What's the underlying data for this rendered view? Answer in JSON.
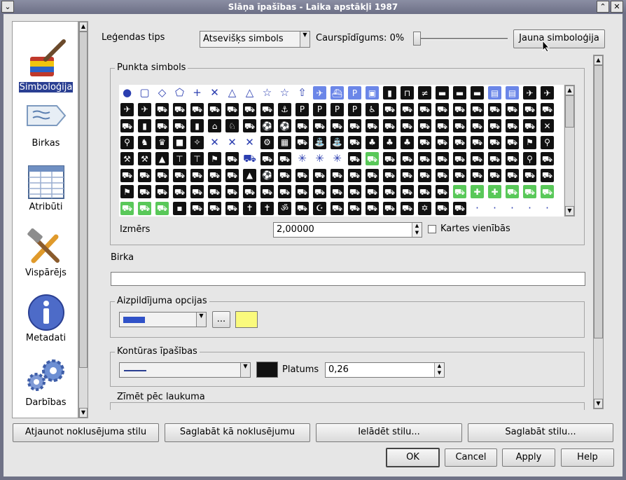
{
  "window": {
    "title": "Slāņa īpašības - Laika apstākļi 1987"
  },
  "sidebar": {
    "items": [
      {
        "label": "Simboloģija",
        "icon": "paintbrush-icon",
        "selected": true
      },
      {
        "label": "Birkas",
        "icon": "label-tag-icon"
      },
      {
        "label": "Atribūti",
        "icon": "table-icon"
      },
      {
        "label": "Vispārējs",
        "icon": "tools-icon"
      },
      {
        "label": "Metadati",
        "icon": "info-icon"
      },
      {
        "label": "Darbības",
        "icon": "gears-icon"
      }
    ]
  },
  "symbology": {
    "legend_type_label": "Leģendas tips",
    "legend_type_value": "Atsevišķs simbols",
    "transparency_label": "Caurspīdīgums: 0%",
    "transparency_value": 0,
    "new_symbology_button": "Jauna simboloģija",
    "point_symbol_group": "Punkta simbols",
    "size_label": "Izmērs",
    "size_value": "2,00000",
    "map_units_label": "Kartes vienībās",
    "map_units_checked": false,
    "label_group": "Birka",
    "label_value": "",
    "fill_options_group": "Aizpildījuma opcijas",
    "fill_color": "#3052c8",
    "fill_color2": "#fafa7d",
    "fill_more_button": "...",
    "outline_group": "Kontūras īpašības",
    "outline_color": "#111111",
    "width_label": "Platums",
    "width_value": "0,26",
    "draw_by_field_group": "Zīmēt pēc laukuma"
  },
  "symbols": [
    {
      "t": "o",
      "g": "●"
    },
    {
      "t": "o",
      "g": "▢"
    },
    {
      "t": "o",
      "g": "◇"
    },
    {
      "t": "o",
      "g": "⬠"
    },
    {
      "t": "o",
      "g": "+"
    },
    {
      "t": "o",
      "g": "✕"
    },
    {
      "t": "o",
      "g": "△"
    },
    {
      "t": "o",
      "g": "△"
    },
    {
      "t": "o",
      "g": "☆"
    },
    {
      "t": "o",
      "g": "☆"
    },
    {
      "t": "o",
      "g": "⇧"
    },
    {
      "t": "l",
      "g": "✈"
    },
    {
      "t": "l",
      "g": "⛴"
    },
    {
      "t": "l",
      "g": "P"
    },
    {
      "t": "l",
      "g": "▣"
    },
    {
      "t": "b",
      "g": "▮"
    },
    {
      "t": "b",
      "g": "⊓"
    },
    {
      "t": "b",
      "g": "≠"
    },
    {
      "t": "b",
      "g": "▬"
    },
    {
      "t": "b",
      "g": "▬"
    },
    {
      "t": "b",
      "g": "▬"
    },
    {
      "t": "l",
      "g": "▤"
    },
    {
      "t": "l",
      "g": "▤"
    },
    {
      "t": "b",
      "g": "✈"
    },
    {
      "t": "b",
      "g": "✈"
    },
    {
      "t": "b",
      "g": "✈"
    },
    {
      "t": "b",
      "g": "✈"
    },
    {
      "t": "b",
      "g": "⛟"
    },
    {
      "t": "b",
      "g": "⛟"
    },
    {
      "t": "b",
      "g": "⛟"
    },
    {
      "t": "b",
      "g": "⛟"
    },
    {
      "t": "b",
      "g": "⛟"
    },
    {
      "t": "b",
      "g": "⛟"
    },
    {
      "t": "b",
      "g": "⛟"
    },
    {
      "t": "b",
      "g": "⚓"
    },
    {
      "t": "b",
      "g": "P"
    },
    {
      "t": "b",
      "g": "P"
    },
    {
      "t": "b",
      "g": "P"
    },
    {
      "t": "b",
      "g": "P"
    },
    {
      "t": "b",
      "g": "♿"
    },
    {
      "t": "b",
      "g": "⛟"
    },
    {
      "t": "b",
      "g": "⛟"
    },
    {
      "t": "b",
      "g": "⛟"
    },
    {
      "t": "b",
      "g": "⛟"
    },
    {
      "t": "b",
      "g": "⛟"
    },
    {
      "t": "b",
      "g": "⛟"
    },
    {
      "t": "b",
      "g": "⛟"
    },
    {
      "t": "b",
      "g": "⛟"
    },
    {
      "t": "b",
      "g": "⛟"
    },
    {
      "t": "b",
      "g": "⛟"
    },
    {
      "t": "b",
      "g": "⛟"
    },
    {
      "t": "b",
      "g": "▮"
    },
    {
      "t": "b",
      "g": "⛟"
    },
    {
      "t": "b",
      "g": "⛟"
    },
    {
      "t": "b",
      "g": "▮"
    },
    {
      "t": "b",
      "g": "⌂"
    },
    {
      "t": "b",
      "g": "♘"
    },
    {
      "t": "b",
      "g": "⛟"
    },
    {
      "t": "b",
      "g": "⚽"
    },
    {
      "t": "b",
      "g": "⚽"
    },
    {
      "t": "b",
      "g": "⛟"
    },
    {
      "t": "b",
      "g": "⛟"
    },
    {
      "t": "b",
      "g": "⛟"
    },
    {
      "t": "b",
      "g": "⛟"
    },
    {
      "t": "b",
      "g": "⛟"
    },
    {
      "t": "b",
      "g": "⛟"
    },
    {
      "t": "b",
      "g": "⛟"
    },
    {
      "t": "b",
      "g": "⛟"
    },
    {
      "t": "b",
      "g": "⛟"
    },
    {
      "t": "b",
      "g": "⛟"
    },
    {
      "t": "b",
      "g": "⛟"
    },
    {
      "t": "b",
      "g": "⛟"
    },
    {
      "t": "b",
      "g": "⛟"
    },
    {
      "t": "b",
      "g": "⛟"
    },
    {
      "t": "b",
      "g": "✕"
    },
    {
      "t": "b",
      "g": "⚲"
    },
    {
      "t": "b",
      "g": "♞"
    },
    {
      "t": "b",
      "g": "♛"
    },
    {
      "t": "b",
      "g": "■"
    },
    {
      "t": "b",
      "g": "✧"
    },
    {
      "t": "o",
      "g": "✕"
    },
    {
      "t": "o",
      "g": "✕"
    },
    {
      "t": "o",
      "g": "✕"
    },
    {
      "t": "b",
      "g": "⚙"
    },
    {
      "t": "b",
      "g": "▦"
    },
    {
      "t": "b",
      "g": "⛟"
    },
    {
      "t": "b",
      "g": "⛲"
    },
    {
      "t": "b",
      "g": "⛲"
    },
    {
      "t": "b",
      "g": "⛟"
    },
    {
      "t": "b",
      "g": "♣"
    },
    {
      "t": "b",
      "g": "♣"
    },
    {
      "t": "b",
      "g": "♣"
    },
    {
      "t": "b",
      "g": "⛟"
    },
    {
      "t": "b",
      "g": "⛟"
    },
    {
      "t": "b",
      "g": "⛟"
    },
    {
      "t": "b",
      "g": "⛟"
    },
    {
      "t": "b",
      "g": "⛟"
    },
    {
      "t": "b",
      "g": "⛟"
    },
    {
      "t": "b",
      "g": "⚑"
    },
    {
      "t": "b",
      "g": "⚲"
    },
    {
      "t": "b",
      "g": "⚒"
    },
    {
      "t": "b",
      "g": "⚒"
    },
    {
      "t": "b",
      "g": "▲"
    },
    {
      "t": "b",
      "g": "⊤"
    },
    {
      "t": "b",
      "g": "⊤"
    },
    {
      "t": "b",
      "g": "⚑"
    },
    {
      "t": "b",
      "g": "⛟"
    },
    {
      "t": "o",
      "g": "⛟"
    },
    {
      "t": "b",
      "g": "⛟"
    },
    {
      "t": "b",
      "g": "⛟"
    },
    {
      "t": "o",
      "g": "✳"
    },
    {
      "t": "o",
      "g": "✳"
    },
    {
      "t": "o",
      "g": "✳"
    },
    {
      "t": "b",
      "g": "⛟"
    },
    {
      "t": "g",
      "g": "⛟"
    },
    {
      "t": "b",
      "g": "⛟"
    },
    {
      "t": "b",
      "g": "⛟"
    },
    {
      "t": "b",
      "g": "⛟"
    },
    {
      "t": "b",
      "g": "⛟"
    },
    {
      "t": "b",
      "g": "⛟"
    },
    {
      "t": "b",
      "g": "⛟"
    },
    {
      "t": "b",
      "g": "⛟"
    },
    {
      "t": "b",
      "g": "⛟"
    },
    {
      "t": "b",
      "g": "⚲"
    },
    {
      "t": "b",
      "g": "⛟"
    },
    {
      "t": "b",
      "g": "⛟"
    },
    {
      "t": "b",
      "g": "⛟"
    },
    {
      "t": "b",
      "g": "⛟"
    },
    {
      "t": "b",
      "g": "⛟"
    },
    {
      "t": "b",
      "g": "⛟"
    },
    {
      "t": "b",
      "g": "⛟"
    },
    {
      "t": "b",
      "g": "⛟"
    },
    {
      "t": "b",
      "g": "▲"
    },
    {
      "t": "b",
      "g": "⚽"
    },
    {
      "t": "b",
      "g": "⛟"
    },
    {
      "t": "b",
      "g": "⛟"
    },
    {
      "t": "b",
      "g": "⛟"
    },
    {
      "t": "b",
      "g": "⛟"
    },
    {
      "t": "b",
      "g": "⛟"
    },
    {
      "t": "b",
      "g": "⛟"
    },
    {
      "t": "b",
      "g": "⛟"
    },
    {
      "t": "b",
      "g": "⛟"
    },
    {
      "t": "b",
      "g": "⛟"
    },
    {
      "t": "b",
      "g": "⛟"
    },
    {
      "t": "b",
      "g": "⛟"
    },
    {
      "t": "b",
      "g": "⛟"
    },
    {
      "t": "b",
      "g": "⛟"
    },
    {
      "t": "b",
      "g": "⛟"
    },
    {
      "t": "b",
      "g": "⛟"
    },
    {
      "t": "b",
      "g": "⛟"
    },
    {
      "t": "b",
      "g": "⚑"
    },
    {
      "t": "b",
      "g": "⛟"
    },
    {
      "t": "b",
      "g": "⛟"
    },
    {
      "t": "b",
      "g": "⛟"
    },
    {
      "t": "b",
      "g": "⛟"
    },
    {
      "t": "b",
      "g": "⛟"
    },
    {
      "t": "b",
      "g": "⛟"
    },
    {
      "t": "b",
      "g": "⛟"
    },
    {
      "t": "b",
      "g": "⛟"
    },
    {
      "t": "b",
      "g": "⛟"
    },
    {
      "t": "b",
      "g": "⛟"
    },
    {
      "t": "b",
      "g": "⛟"
    },
    {
      "t": "b",
      "g": "⛟"
    },
    {
      "t": "b",
      "g": "⛟"
    },
    {
      "t": "b",
      "g": "⛟"
    },
    {
      "t": "b",
      "g": "⛟"
    },
    {
      "t": "b",
      "g": "⛟"
    },
    {
      "t": "b",
      "g": "⛟"
    },
    {
      "t": "b",
      "g": "⛟"
    },
    {
      "t": "g",
      "g": "⛟"
    },
    {
      "t": "g",
      "g": "✚"
    },
    {
      "t": "g",
      "g": "✚"
    },
    {
      "t": "g",
      "g": "⛟"
    },
    {
      "t": "g",
      "g": "⛟"
    },
    {
      "t": "g",
      "g": "⛟"
    },
    {
      "t": "g",
      "g": "⛟"
    },
    {
      "t": "g",
      "g": "⛟"
    },
    {
      "t": "g",
      "g": "⛟"
    },
    {
      "t": "b",
      "g": "▪"
    },
    {
      "t": "b",
      "g": "⛟"
    },
    {
      "t": "b",
      "g": "⛟"
    },
    {
      "t": "b",
      "g": "⛟"
    },
    {
      "t": "b",
      "g": "✝"
    },
    {
      "t": "b",
      "g": "✝"
    },
    {
      "t": "b",
      "g": "ॐ"
    },
    {
      "t": "b",
      "g": "⛟"
    },
    {
      "t": "b",
      "g": "☪"
    },
    {
      "t": "b",
      "g": "⛟"
    },
    {
      "t": "b",
      "g": "⛟"
    },
    {
      "t": "b",
      "g": "⛟"
    },
    {
      "t": "b",
      "g": "⛟"
    },
    {
      "t": "b",
      "g": "⛟"
    },
    {
      "t": "b",
      "g": "✡"
    },
    {
      "t": "b",
      "g": "⛟"
    },
    {
      "t": "b",
      "g": "⛟"
    },
    {
      "t": "o",
      "g": "·"
    },
    {
      "t": "o",
      "g": "·"
    },
    {
      "t": "o",
      "g": "·"
    },
    {
      "t": "o",
      "g": "·"
    },
    {
      "t": "o",
      "g": "·"
    },
    {
      "t": "o",
      "g": "·"
    },
    {
      "t": "o",
      "g": "·"
    },
    {
      "t": "o",
      "g": "·"
    },
    {
      "t": "o",
      "g": "·"
    },
    {
      "t": "o",
      "g": "·"
    },
    {
      "t": "o",
      "g": "·"
    },
    {
      "t": "o",
      "g": "·"
    },
    {
      "t": "o",
      "g": "·"
    },
    {
      "t": "o",
      "g": "·"
    },
    {
      "t": "o",
      "g": "·"
    },
    {
      "t": "o",
      "g": "·"
    },
    {
      "t": "o",
      "g": "·"
    },
    {
      "t": "o",
      "g": "·"
    },
    {
      "t": "o",
      "g": "·"
    },
    {
      "t": "o",
      "g": "·"
    },
    {
      "t": "o",
      "g": "·"
    },
    {
      "t": "g",
      "g": "◆"
    },
    {
      "t": "g",
      "g": "◆"
    },
    {
      "t": "o",
      "g": "⛩"
    },
    {
      "t": "g",
      "g": "◆"
    }
  ],
  "footer": {
    "restore_default": "Atjaunot noklusējuma stilu",
    "save_as_default": "Saglabāt kā noklusējumu",
    "load_style": "Ielādēt stilu...",
    "save_style": "Saglabāt stilu...",
    "ok": "OK",
    "cancel": "Cancel",
    "apply": "Apply",
    "help": "Help"
  }
}
